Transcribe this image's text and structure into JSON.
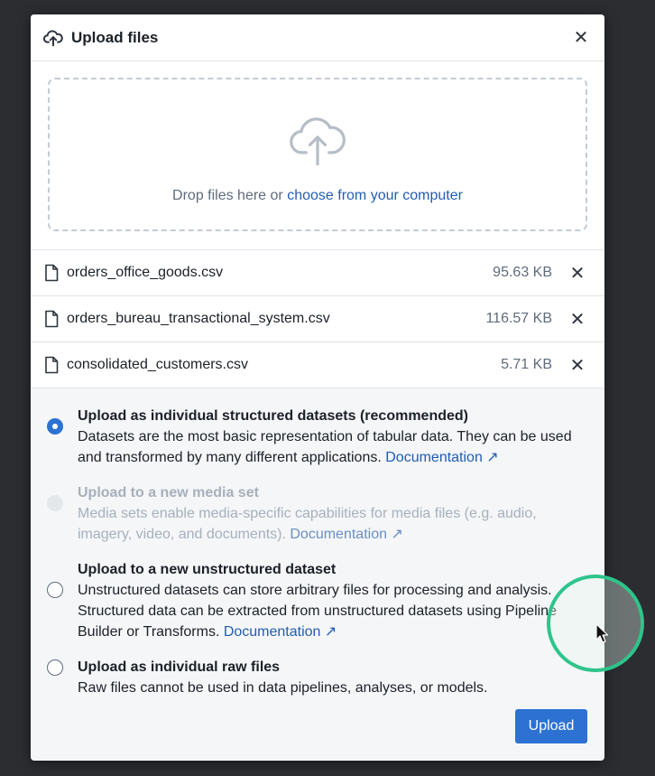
{
  "dialog": {
    "title": "Upload files",
    "header_icon": "upload-cloud-icon",
    "close_icon": "close-icon"
  },
  "dropzone": {
    "icon": "cloud-upload-icon",
    "text": "Drop files here or ",
    "link": "choose from your computer"
  },
  "files": [
    {
      "name": "orders_office_goods.csv",
      "size": "95.63 KB"
    },
    {
      "name": "orders_bureau_transactional_system.csv",
      "size": "116.57 KB"
    },
    {
      "name": "consolidated_customers.csv",
      "size": "5.71 KB"
    }
  ],
  "options": [
    {
      "title": "Upload as individual structured datasets (recommended)",
      "desc": "Datasets are the most basic representation of tabular data. They can be used and transformed by many different applications. ",
      "link": "Documentation ↗",
      "state": "selected"
    },
    {
      "title": "Upload to a new media set",
      "desc": "Media sets enable media-specific capabilities for media files (e.g. audio, imagery, video, and documents). ",
      "link": "Documentation ↗",
      "state": "disabled"
    },
    {
      "title": "Upload to a new unstructured dataset",
      "desc": "Unstructured datasets can store arbitrary files for processing and analysis. Structured data can be extracted from unstructured datasets using Pipeline Builder or Transforms. ",
      "link": "Documentation ↗",
      "state": "unselected"
    },
    {
      "title": "Upload as individual raw files",
      "desc": "Raw files cannot be used in data pipelines, analyses, or models.",
      "link": "",
      "state": "unselected"
    }
  ],
  "footer": {
    "upload_label": "Upload"
  },
  "colors": {
    "accent": "#2d72d2",
    "link": "#215db0",
    "cursor_highlight": "#2ec48c"
  }
}
